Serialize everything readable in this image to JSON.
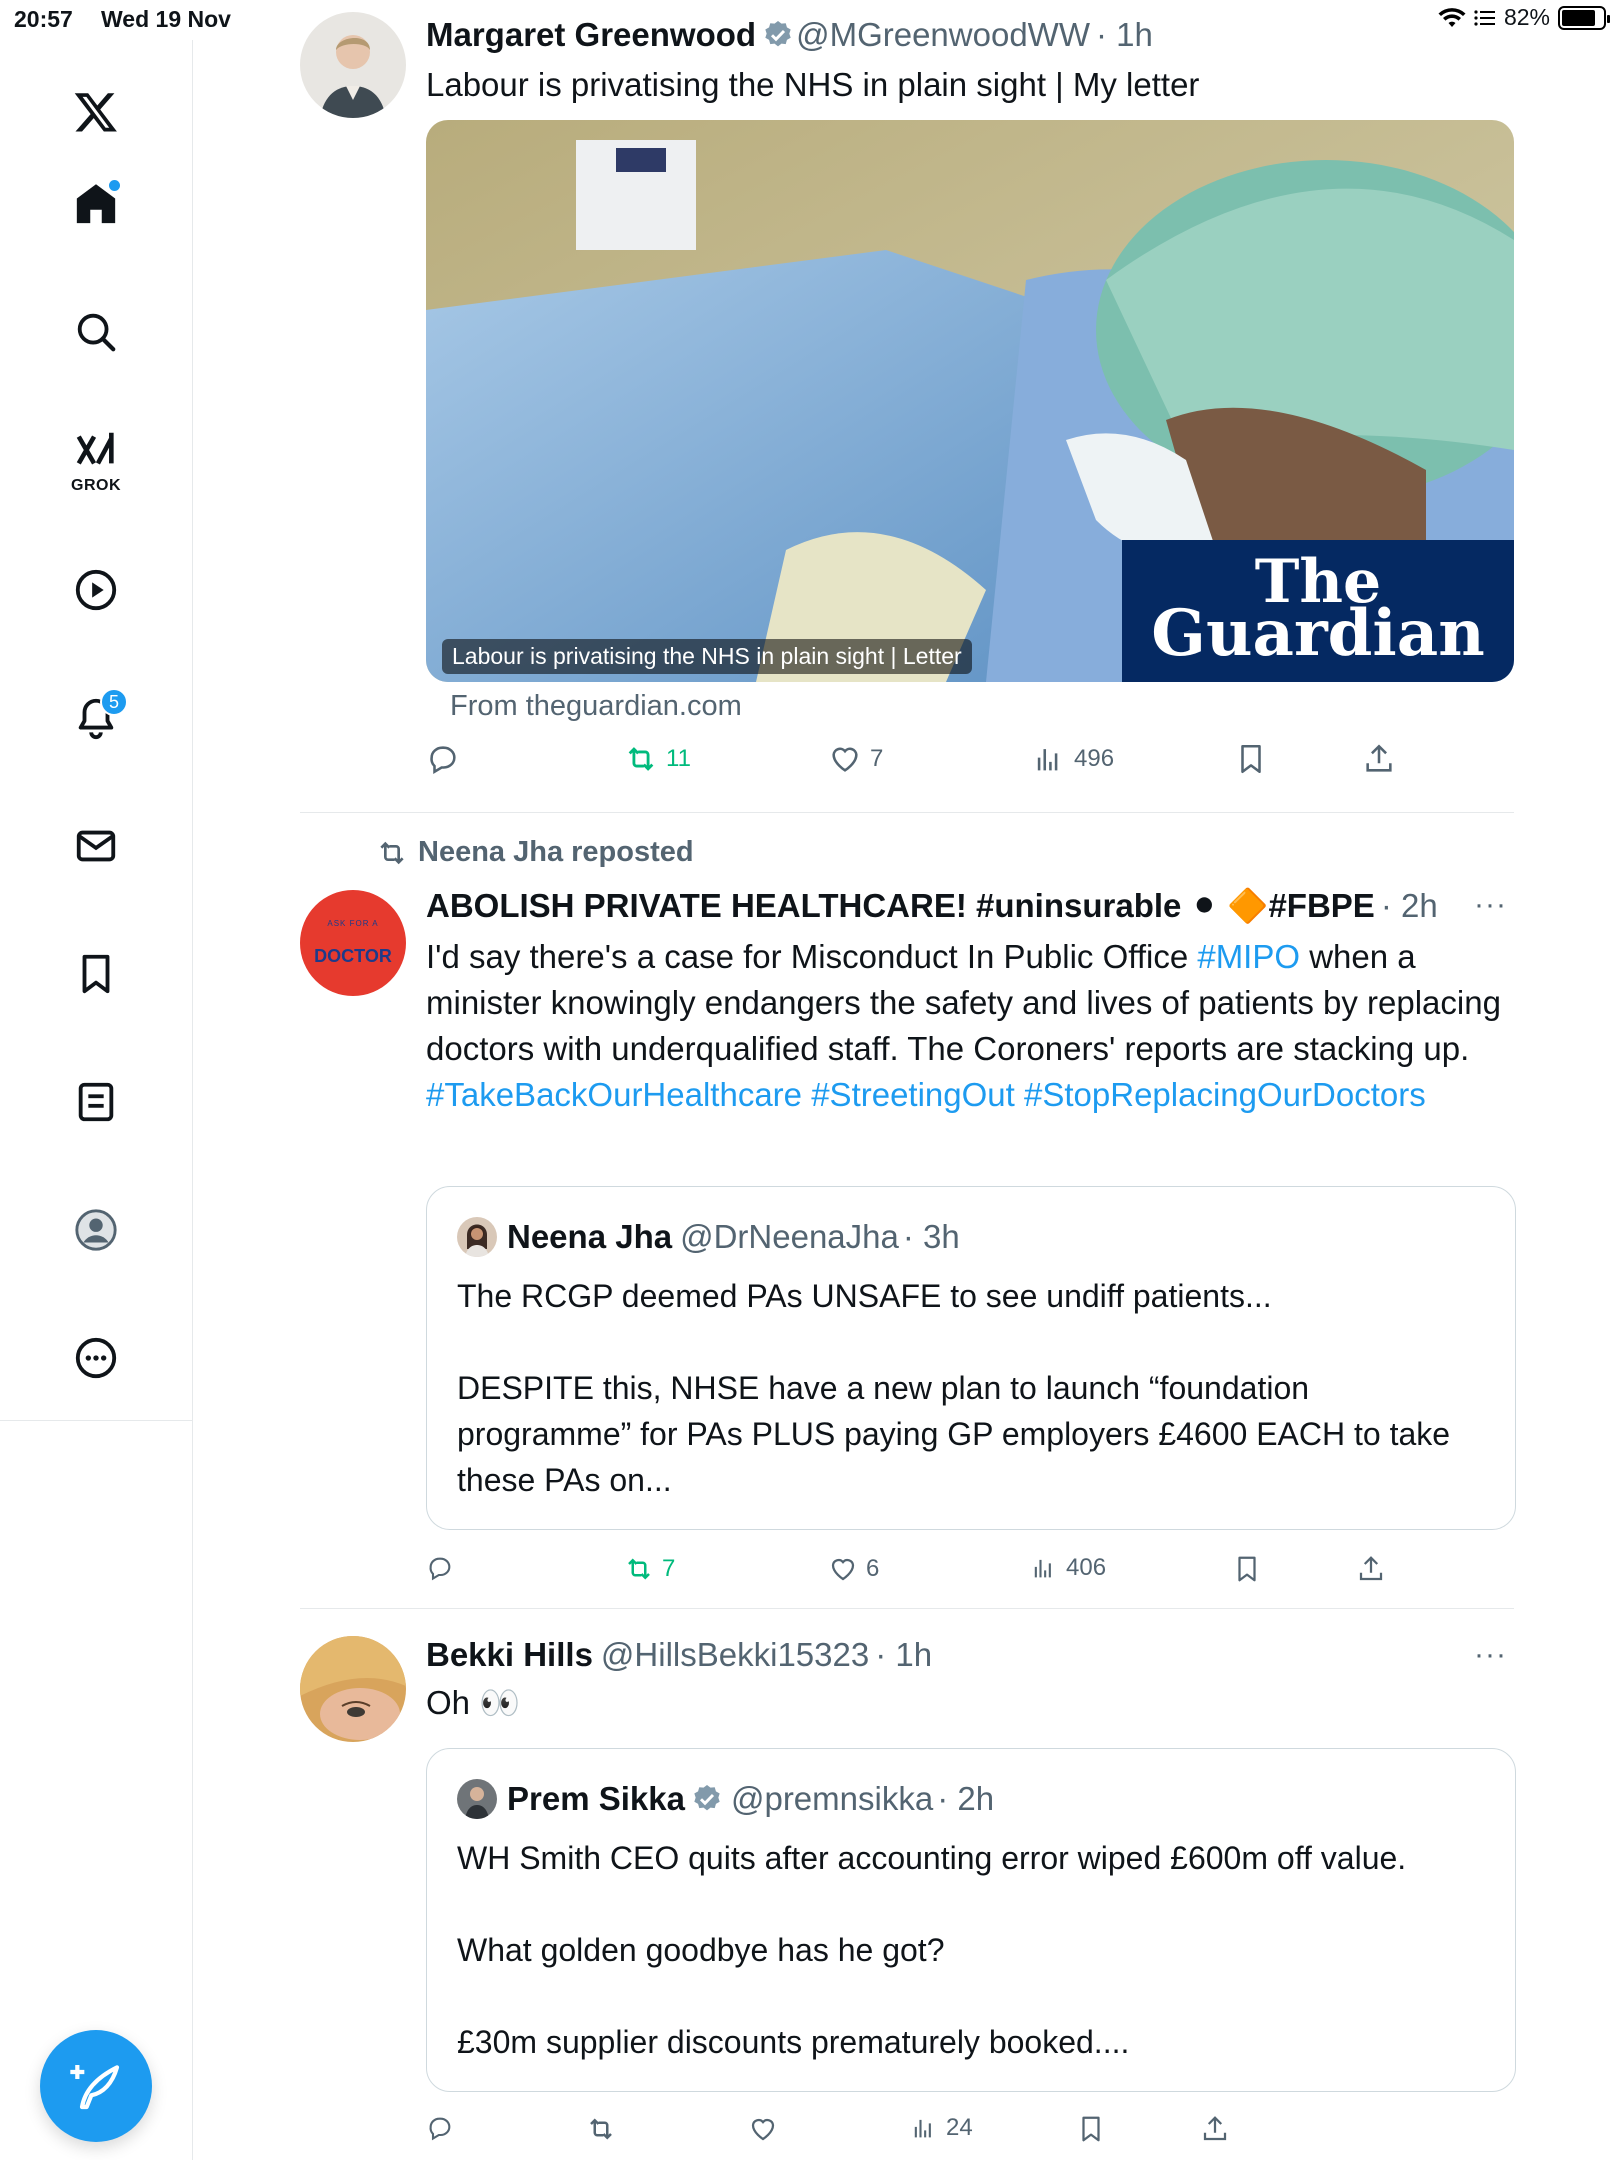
{
  "status_bar": {
    "time": "20:57",
    "date": "Wed 19 Nov",
    "battery": "82%",
    "battery_level": 0.82
  },
  "sidebar": {
    "items": [
      {
        "name": "x-logo"
      },
      {
        "name": "home",
        "has_dot": true
      },
      {
        "name": "search"
      },
      {
        "name": "grok",
        "label": "GROK"
      },
      {
        "name": "video"
      },
      {
        "name": "notifications",
        "badge": "5"
      },
      {
        "name": "messages"
      },
      {
        "name": "bookmarks"
      },
      {
        "name": "lists"
      },
      {
        "name": "profile"
      },
      {
        "name": "more"
      }
    ]
  },
  "tweets": [
    {
      "name": "Margaret Greenwood",
      "handle": "@MGreenwoodWW",
      "time": "· 1h",
      "verified": true,
      "text": "Labour is privatising the NHS in plain sight | My letter",
      "card": {
        "caption": "Labour is privatising the NHS in plain sight | Letter",
        "brand_line1": "The",
        "brand_line2": "Guardian",
        "source": "From theguardian.com"
      },
      "actions": {
        "reply": "",
        "repost": "11",
        "like": "7",
        "views": "496"
      }
    },
    {
      "repost_by": "Neena Jha reposted",
      "name": "ABOLISH PRIVATE HEALTHCARE! #uninsurable ⚫ 🔶#FBPE",
      "time": "· 2h",
      "avatar_text_top": "ASK FOR A",
      "avatar_text": "DOCTOR",
      "text_parts": [
        {
          "t": "I'd say there's a case for Misconduct In Public Office "
        },
        {
          "t": "#MIPO",
          "tag": true
        },
        {
          "t": " when a minister knowingly endangers the safety and lives of patients by replacing doctors with underqualified staff. The Coroners' reports are stacking up. "
        },
        {
          "t": "#TakeBackOurHealthcare",
          "tag": true
        },
        {
          "t": " "
        },
        {
          "t": "#StreetingOut",
          "tag": true
        },
        {
          "t": " "
        },
        {
          "t": "#StopReplacingOurDoctors",
          "tag": true
        }
      ],
      "quote": {
        "name": "Neena Jha",
        "handle": "@DrNeenaJha",
        "time": "· 3h",
        "text": "The RCGP deemed PAs UNSAFE to see undiff patients...\n\nDESPITE this, NHSE have a new plan to launch “foundation programme” for PAs PLUS paying GP employers £4600 EACH to take these PAs on..."
      },
      "actions": {
        "reply": "",
        "repost": "7",
        "like": "6",
        "views": "406"
      }
    },
    {
      "name": "Bekki Hills",
      "handle": "@HillsBekki15323",
      "time": "· 1h",
      "text": "Oh 👀",
      "quote": {
        "name": "Prem Sikka",
        "handle": "@premnsikka",
        "time": "· 2h",
        "verified": true,
        "text": "WH Smith CEO quits after accounting error wiped £600m off value.\n\nWhat golden goodbye has he got?\n\n£30m supplier discounts prematurely booked...."
      },
      "actions": {
        "reply": "",
        "repost": "",
        "like": "",
        "views": "24"
      }
    }
  ],
  "colors": {
    "accent": "#1d9bf0",
    "repost_active": "#00ba7c",
    "text_secondary": "#536471",
    "guardian": "#052962"
  }
}
